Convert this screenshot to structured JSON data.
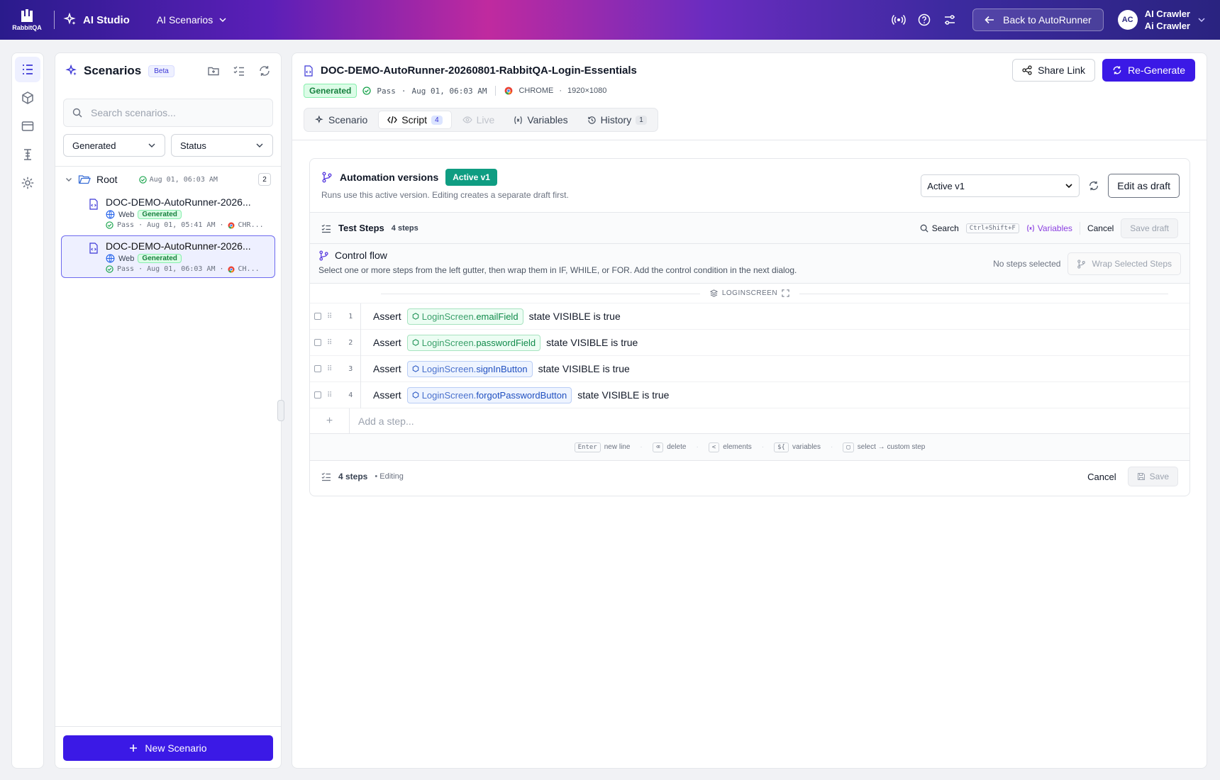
{
  "topbar": {
    "logo_text": "RabbitQA",
    "brand": "AI Studio",
    "section": "AI Scenarios",
    "back_button": "Back to AutoRunner",
    "avatar_initials": "AC",
    "user_name": "AI Crawler",
    "user_sub": "Ai Crawler",
    "icons": [
      "broadcast-icon",
      "help-icon",
      "settings-sliders-icon"
    ]
  },
  "rail": {
    "items": [
      "scenarios-list-icon",
      "package-icon",
      "browser-window-icon",
      "steps-icon",
      "gear-icon"
    ],
    "active_index": 0
  },
  "scenarios_panel": {
    "title": "Scenarios",
    "beta": "Beta",
    "search_placeholder": "Search scenarios...",
    "filter_generated": "Generated",
    "filter_status": "Status",
    "root": {
      "label": "Root",
      "date": "Aug 01, 06:03 AM",
      "count": "2"
    },
    "items": [
      {
        "name": "DOC-DEMO-AutoRunner-2026...",
        "platform": "Web",
        "tag": "Generated",
        "status": "Pass · Aug 01, 05:41 AM ·",
        "browser": "CHR..."
      },
      {
        "name": "DOC-DEMO-AutoRunner-2026...",
        "platform": "Web",
        "tag": "Generated",
        "status": "Pass · Aug 01, 06:03 AM ·",
        "browser": "CH..."
      }
    ],
    "selected_index": 1,
    "new_button": "New Scenario"
  },
  "main": {
    "title": "DOC-DEMO-AutoRunner-20260801-RabbitQA-Login-Essentials",
    "tag": "Generated",
    "status": "Pass",
    "date": "Aug 01, 06:03 AM",
    "browser": "CHROME",
    "resolution": "1920×1080",
    "share_button": "Share Link",
    "regenerate_button": "Re-Generate",
    "tabs": [
      {
        "label": "Scenario",
        "count": ""
      },
      {
        "label": "Script",
        "count": "4"
      },
      {
        "label": "Live",
        "count": ""
      },
      {
        "label": "Variables",
        "count": ""
      },
      {
        "label": "History",
        "count": "1"
      }
    ],
    "active_tab": 1
  },
  "versions": {
    "title": "Automation versions",
    "active_tag": "Active v1",
    "subtitle": "Runs use this active version. Editing creates a separate draft first.",
    "select_value": "Active v1",
    "edit_button": "Edit as draft"
  },
  "test_steps": {
    "label": "Test Steps",
    "count": "4 steps",
    "search": "Search",
    "shortcut": "Ctrl+Shift+F",
    "variables": "Variables",
    "cancel": "Cancel",
    "save_draft": "Save draft"
  },
  "control_flow": {
    "title": "Control flow",
    "subtitle": "Select one or more steps from the left gutter, then wrap them in IF, WHILE, or FOR. Add the control condition in the next dialog.",
    "no_selection": "No steps selected",
    "wrap_button": "Wrap Selected Steps"
  },
  "group_label": "LOGINSCREEN",
  "steps": [
    {
      "num": "1",
      "keyword": "Assert",
      "screen": "LoginScreen.",
      "element": "emailField",
      "condition": "state VISIBLE is true",
      "color": "green"
    },
    {
      "num": "2",
      "keyword": "Assert",
      "screen": "LoginScreen.",
      "element": "passwordField",
      "condition": "state VISIBLE is true",
      "color": "green"
    },
    {
      "num": "3",
      "keyword": "Assert",
      "screen": "LoginScreen.",
      "element": "signInButton",
      "condition": "state VISIBLE is true",
      "color": "blue"
    },
    {
      "num": "4",
      "keyword": "Assert",
      "screen": "LoginScreen.",
      "element": "forgotPasswordButton",
      "condition": "state VISIBLE is true",
      "color": "blue"
    }
  ],
  "add_step_placeholder": "Add a step...",
  "hints": [
    {
      "key": "Enter",
      "label": "new line"
    },
    {
      "key": "⌫",
      "label": "delete"
    },
    {
      "key": "<",
      "label": "elements"
    },
    {
      "key": "${",
      "label": "variables"
    },
    {
      "key": "▢",
      "label": "select → custom step"
    }
  ],
  "footer": {
    "steps": "4 steps",
    "state": "• Editing",
    "cancel": "Cancel",
    "save": "Save"
  }
}
